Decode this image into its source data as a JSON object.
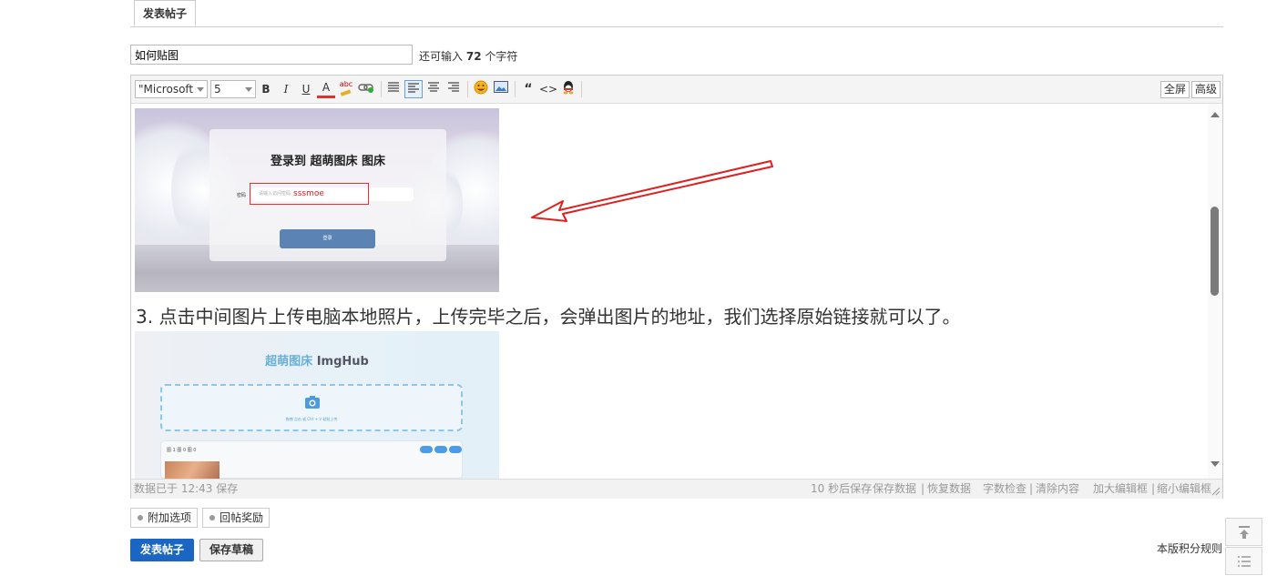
{
  "tab": {
    "label": "发表帖子"
  },
  "subject": {
    "value": "如何贴图",
    "remain_prefix": "还可输入",
    "remain_count": "72",
    "remain_suffix": "个字符"
  },
  "toolbar": {
    "font_family": "\"Microsoft",
    "font_size": "5",
    "bold": "B",
    "italic": "I",
    "underline": "U",
    "forecolor": "A",
    "spell": "abc",
    "quote": "“",
    "code": "<>",
    "fullscreen": "全屏",
    "advanced": "高级"
  },
  "content": {
    "image1": {
      "title": "登录到 超萌图床 图床",
      "field_label": "密码",
      "field_placeholder": "请输入访问密码",
      "typed": "sssmoe",
      "button": "登录"
    },
    "caption": "3. 点击中间图片上传电脑本地照片，上传完毕之后，会弹出图片的地址，我们选择原始链接就可以了。",
    "image2": {
      "title_colored": "超萌图床",
      "title_rest": " ImgHub",
      "drop_text": "拖拽 点击 或 Ctrl + V 粘贴上传",
      "list_text": "图 1  图 0  图 0"
    }
  },
  "status": {
    "saved": "数据已于 12:43 保存",
    "autosave": "10 秒后保存",
    "save_data": "保存数据",
    "restore": "恢复数据",
    "wordcheck": "字数检查",
    "clear": "清除内容",
    "enlarge": "加大编辑框",
    "shrink": "缩小编辑框",
    "sep": "|"
  },
  "options": {
    "extra": "附加选项",
    "reward": "回帖奖励"
  },
  "actions": {
    "submit": "发表帖子",
    "draft": "保存草稿"
  },
  "rules": "本版积分规则",
  "colors": {
    "primary_button": "#1a66c2",
    "annotation_red": "#e23232"
  },
  "icons": [
    "link-icon",
    "align-left-icon",
    "align-center-icon",
    "align-right-icon",
    "align-justify-icon",
    "emoticon-icon",
    "image-icon",
    "quote-icon",
    "code-icon",
    "qq-icon",
    "back-to-top-icon",
    "list-icon",
    "camera-icon"
  ]
}
